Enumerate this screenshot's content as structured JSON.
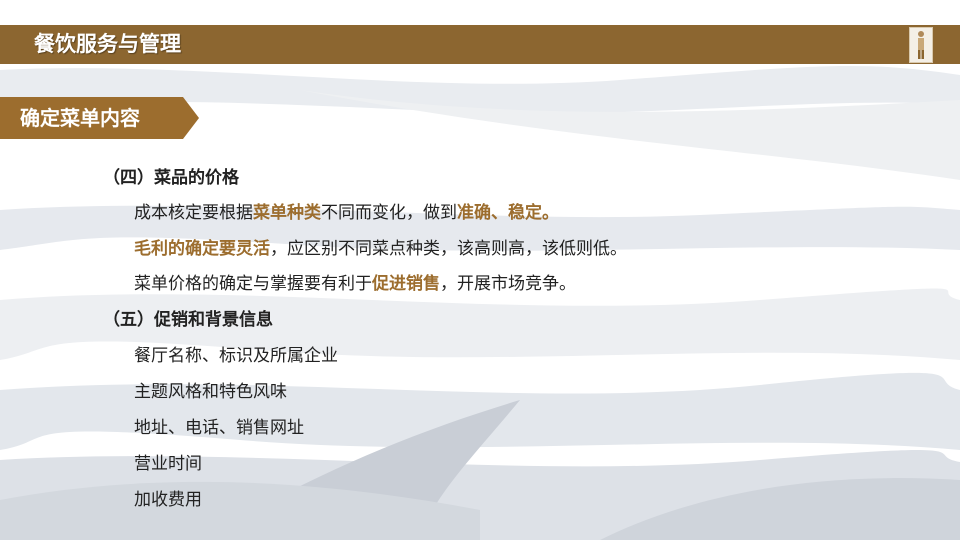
{
  "header": {
    "title": "餐饮服务与管理",
    "logo_icon": "figure-logo-icon"
  },
  "section": {
    "label": "确定菜单内容"
  },
  "colors": {
    "title_bar": "#8c6630",
    "tab": "#9c6d2e",
    "highlight": "#9c6d2e",
    "text": "#222222"
  },
  "content": {
    "part4": {
      "heading": "（四）菜品的价格",
      "line1": {
        "a": "成本核定要根据",
        "b": "菜单种类",
        "c": "不同而变化，做到",
        "d": "准确",
        "e": "、",
        "f": "稳定",
        "g": "。"
      },
      "line2": {
        "a": "毛利的确定要灵活",
        "b": "，应区别不同菜点种类，该高则高，该低则低。"
      },
      "line3": {
        "a": "菜单价格的确定与掌握要有利于",
        "b": "促进销售",
        "c": "，开展市场竞争。"
      }
    },
    "part5": {
      "heading": "（五）促销和背景信息",
      "items": [
        "餐厅名称、标识及所属企业",
        "主题风格和特色风味",
        "地址、电话、销售网址",
        "营业时间",
        "加收费用"
      ]
    }
  }
}
